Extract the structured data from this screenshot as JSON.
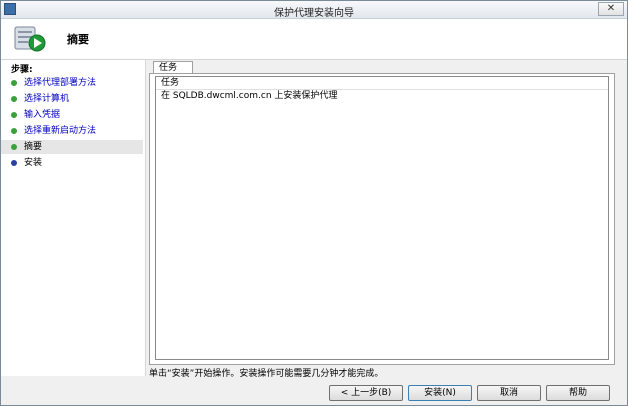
{
  "window": {
    "title": "保护代理安装向导",
    "close_glyph": "✕"
  },
  "header": {
    "title": "摘要",
    "icon": "wizard-install-icon"
  },
  "sidebar": {
    "steps_label": "步骤:",
    "steps": [
      {
        "label": "选择代理部署方法",
        "state": "done"
      },
      {
        "label": "选择计算机",
        "state": "done"
      },
      {
        "label": "输入凭据",
        "state": "done"
      },
      {
        "label": "选择重新启动方法",
        "state": "done"
      },
      {
        "label": "摘要",
        "state": "current"
      },
      {
        "label": "安装",
        "state": "pending"
      }
    ]
  },
  "main": {
    "tab_label": "任务",
    "task_column_header": "任务",
    "tasks": [
      "在 SQLDB.dwcml.com.cn 上安装保护代理"
    ]
  },
  "status_text": "单击“安装”开始操作。安装操作可能需要几分钟才能完成。",
  "buttons": {
    "back": "< 上一步(B)",
    "install": "安装(N)",
    "cancel": "取消",
    "help": "帮助"
  },
  "colors": {
    "done_dot": "#3aa13a",
    "pending_dot": "#2a40a0",
    "link_text": "#0000c0"
  }
}
